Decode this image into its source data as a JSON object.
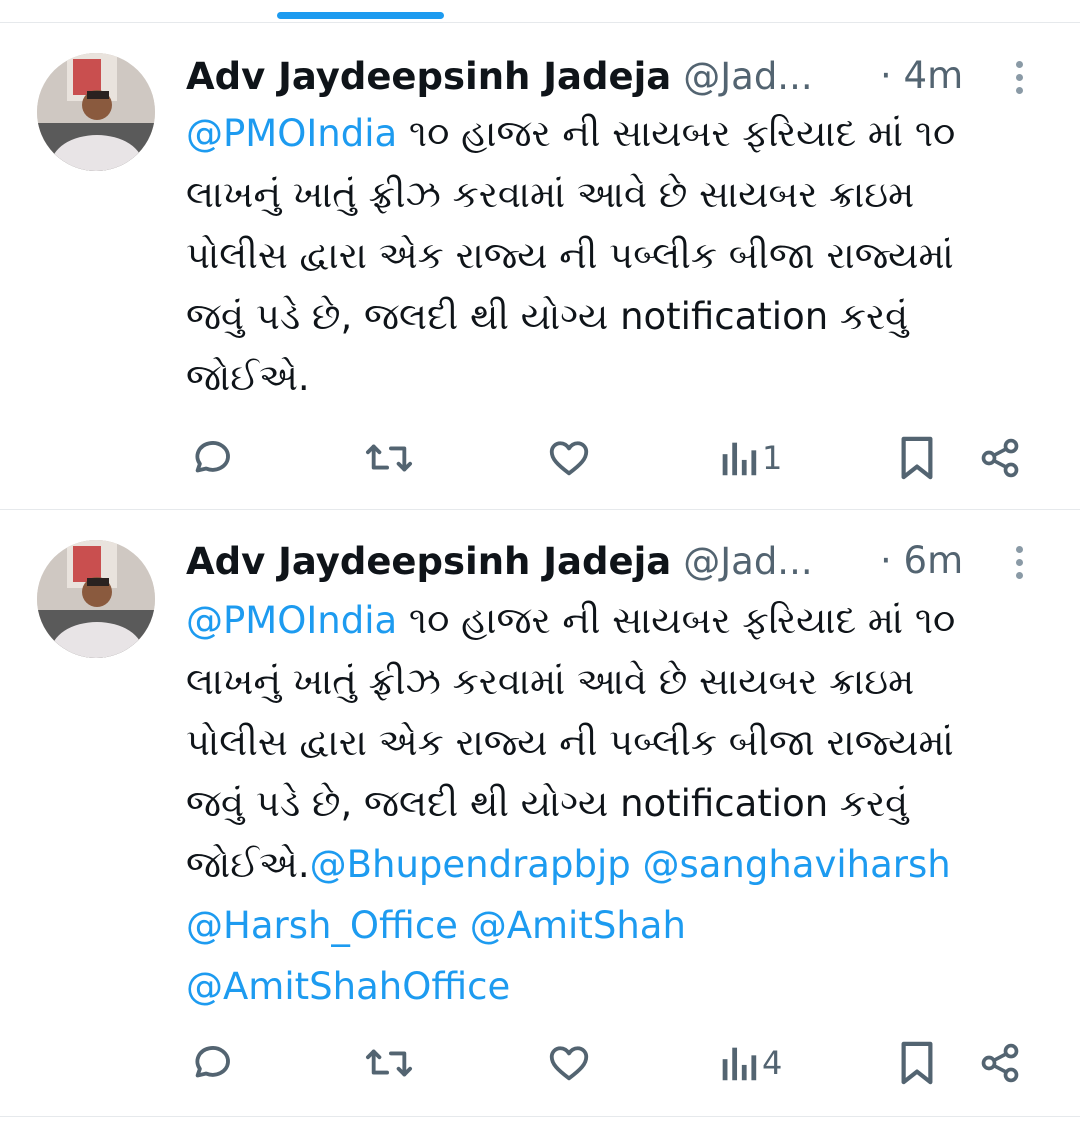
{
  "tweets": [
    {
      "name": "Adv Jaydeepsinh Jadeja",
      "handle": "@Jad...",
      "time": "· 4m",
      "lines": [
        [
          {
            "t": "@PMOIndia",
            "m": true
          },
          {
            "t": " ૧૦ હાજર ની સાયબર ફરિયાદ માં ૧૦",
            "m": false
          }
        ],
        [
          {
            "t": "લાખનું ખાતું ફ્રીઝ કરવામાં આવે છે સાયબર ક્રાઇમ",
            "m": false
          }
        ],
        [
          {
            "t": "પોલીસ દ્વારા એક રાજ્ય ની પબ્લીક બીજા રાજ્યમાં",
            "m": false
          }
        ],
        [
          {
            "t": "જવું પડે છે, જલદી થી યોગ્ય notification કરવું",
            "m": false
          }
        ],
        [
          {
            "t": "જોઈએ.",
            "m": false
          }
        ]
      ],
      "views": "1"
    },
    {
      "name": "Adv Jaydeepsinh Jadeja",
      "handle": "@Jad...",
      "time": "· 6m",
      "lines": [
        [
          {
            "t": "@PMOIndia",
            "m": true
          },
          {
            "t": " ૧૦ હાજર ની સાયબર ફરિયાદ માં ૧૦",
            "m": false
          }
        ],
        [
          {
            "t": "લાખનું ખાતું ફ્રીઝ કરવામાં આવે છે સાયબર ક્રાઇમ",
            "m": false
          }
        ],
        [
          {
            "t": "પોલીસ દ્વારા એક રાજ્ય ની પબ્લીક બીજા રાજ્યમાં",
            "m": false
          }
        ],
        [
          {
            "t": "જવું પડે છે, જલદી થી યોગ્ય notification કરવું",
            "m": false
          }
        ],
        [
          {
            "t": "જોઈએ.",
            "m": false
          },
          {
            "t": "@Bhupendrapbjp @sanghaviharsh",
            "m": true
          }
        ],
        [
          {
            "t": "@Harsh_Office @AmitShah",
            "m": true
          }
        ],
        [
          {
            "t": "@AmitShahOffice",
            "m": true
          }
        ]
      ],
      "views": "4"
    }
  ],
  "icons": {
    "reply": "reply-icon",
    "retweet": "retweet-icon",
    "like": "heart-icon",
    "views": "views-icon",
    "bookmark": "bookmark-icon",
    "share": "share-icon",
    "more": "more-dots-icon"
  },
  "colors": {
    "accent": "#1d9bf0",
    "text": "#0f1419",
    "muted": "#536471"
  }
}
